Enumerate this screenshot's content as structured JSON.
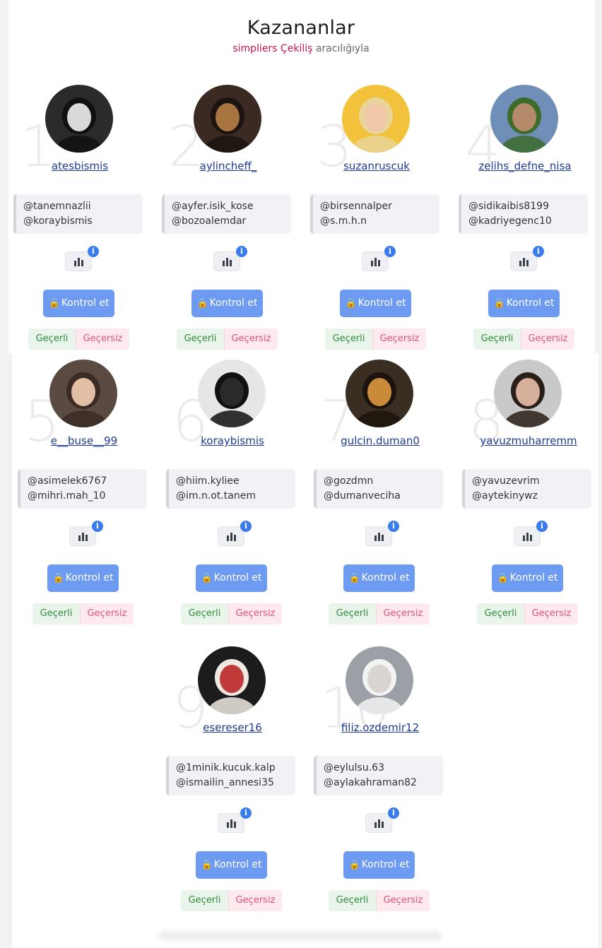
{
  "page": {
    "title": "Kazananlar",
    "subtitle_brand": "simpliers Çekiliş",
    "subtitle_note": "aracılığıyla"
  },
  "buttons": {
    "check_label": "Kontrol et",
    "valid_label": "Geçerli",
    "invalid_label": "Geçersiz",
    "info_glyph": "i",
    "lock_icon": "lock-icon",
    "stats_icon": "bar-chart-icon"
  },
  "colors": {
    "brand": "#c8154f",
    "username": "#1f3a93",
    "check_button": "#6e9bf2",
    "info_badge": "#3a7cf0",
    "valid_text": "#2e8b3a",
    "invalid_text": "#e0517a"
  },
  "winners": [
    {
      "rank": "1.",
      "username": "atesbismis",
      "mentions": [
        "@tanemnazlii",
        "@koraybismis"
      ]
    },
    {
      "rank": "2.",
      "username": "aylincheff_",
      "mentions": [
        "@ayfer.isik_kose",
        "@bozoalemdar"
      ]
    },
    {
      "rank": "3.",
      "username": "suzanruscuk",
      "mentions": [
        "@birsennalper",
        "@s.m.h.n"
      ]
    },
    {
      "rank": "4.",
      "username": "zelihs_defne_nisa",
      "mentions": [
        "@sidikaibis8199",
        "@kadriyegenc10"
      ]
    },
    {
      "rank": "5.",
      "username": "e__buse__99",
      "mentions": [
        "@asimelek6767",
        "@mihri.mah_10"
      ]
    },
    {
      "rank": "6.",
      "username": "koraybismis",
      "mentions": [
        "@hiim.kyliee",
        "@im.n.ot.tanem"
      ]
    },
    {
      "rank": "7.",
      "username": "gulcin.duman0",
      "mentions": [
        "@gozdmn",
        "@dumanveciha"
      ]
    },
    {
      "rank": "8.",
      "username": "yavuzmuharremm",
      "mentions": [
        "@yavuzevrim",
        "@aytekinywz"
      ]
    },
    {
      "rank": "9.",
      "username": "esereser16",
      "mentions": [
        "@1minik.kucuk.kalp",
        "@ismailin_annesi35"
      ]
    },
    {
      "rank": "10.",
      "username": "filiz.ozdemir12",
      "mentions": [
        "@eylulsu.63",
        "@aylakahraman82"
      ]
    }
  ]
}
